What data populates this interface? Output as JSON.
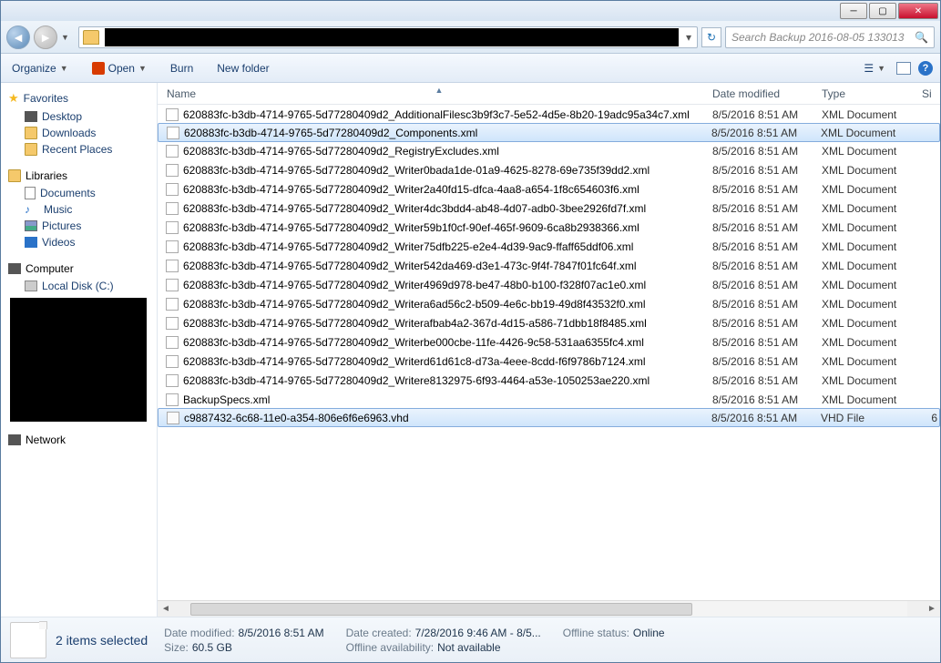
{
  "search": {
    "placeholder": "Search Backup 2016-08-05 133013"
  },
  "toolbar": {
    "organize": "Organize",
    "open": "Open",
    "burn": "Burn",
    "new_folder": "New folder"
  },
  "columns": {
    "name": "Name",
    "date": "Date modified",
    "type": "Type",
    "size": "Si"
  },
  "sidebar": {
    "favorites": {
      "label": "Favorites",
      "items": [
        "Desktop",
        "Downloads",
        "Recent Places"
      ]
    },
    "libraries": {
      "label": "Libraries",
      "items": [
        "Documents",
        "Music",
        "Pictures",
        "Videos"
      ]
    },
    "computer": {
      "label": "Computer",
      "items": [
        "Local Disk (C:)"
      ]
    },
    "network": {
      "label": "Network"
    }
  },
  "files": [
    {
      "name": "620883fc-b3db-4714-9765-5d77280409d2_AdditionalFilesc3b9f3c7-5e52-4d5e-8b20-19adc95a34c7.xml",
      "date": "8/5/2016 8:51 AM",
      "type": "XML Document",
      "sel": false,
      "icon": "xml"
    },
    {
      "name": "620883fc-b3db-4714-9765-5d77280409d2_Components.xml",
      "date": "8/5/2016 8:51 AM",
      "type": "XML Document",
      "sel": true,
      "icon": "xml"
    },
    {
      "name": "620883fc-b3db-4714-9765-5d77280409d2_RegistryExcludes.xml",
      "date": "8/5/2016 8:51 AM",
      "type": "XML Document",
      "sel": false,
      "icon": "xml"
    },
    {
      "name": "620883fc-b3db-4714-9765-5d77280409d2_Writer0bada1de-01a9-4625-8278-69e735f39dd2.xml",
      "date": "8/5/2016 8:51 AM",
      "type": "XML Document",
      "sel": false,
      "icon": "xml"
    },
    {
      "name": "620883fc-b3db-4714-9765-5d77280409d2_Writer2a40fd15-dfca-4aa8-a654-1f8c654603f6.xml",
      "date": "8/5/2016 8:51 AM",
      "type": "XML Document",
      "sel": false,
      "icon": "xml"
    },
    {
      "name": "620883fc-b3db-4714-9765-5d77280409d2_Writer4dc3bdd4-ab48-4d07-adb0-3bee2926fd7f.xml",
      "date": "8/5/2016 8:51 AM",
      "type": "XML Document",
      "sel": false,
      "icon": "xml"
    },
    {
      "name": "620883fc-b3db-4714-9765-5d77280409d2_Writer59b1f0cf-90ef-465f-9609-6ca8b2938366.xml",
      "date": "8/5/2016 8:51 AM",
      "type": "XML Document",
      "sel": false,
      "icon": "xml"
    },
    {
      "name": "620883fc-b3db-4714-9765-5d77280409d2_Writer75dfb225-e2e4-4d39-9ac9-ffaff65ddf06.xml",
      "date": "8/5/2016 8:51 AM",
      "type": "XML Document",
      "sel": false,
      "icon": "xml"
    },
    {
      "name": "620883fc-b3db-4714-9765-5d77280409d2_Writer542da469-d3e1-473c-9f4f-7847f01fc64f.xml",
      "date": "8/5/2016 8:51 AM",
      "type": "XML Document",
      "sel": false,
      "icon": "xml"
    },
    {
      "name": "620883fc-b3db-4714-9765-5d77280409d2_Writer4969d978-be47-48b0-b100-f328f07ac1e0.xml",
      "date": "8/5/2016 8:51 AM",
      "type": "XML Document",
      "sel": false,
      "icon": "xml"
    },
    {
      "name": "620883fc-b3db-4714-9765-5d77280409d2_Writera6ad56c2-b509-4e6c-bb19-49d8f43532f0.xml",
      "date": "8/5/2016 8:51 AM",
      "type": "XML Document",
      "sel": false,
      "icon": "xml"
    },
    {
      "name": "620883fc-b3db-4714-9765-5d77280409d2_Writerafbab4a2-367d-4d15-a586-71dbb18f8485.xml",
      "date": "8/5/2016 8:51 AM",
      "type": "XML Document",
      "sel": false,
      "icon": "xml"
    },
    {
      "name": "620883fc-b3db-4714-9765-5d77280409d2_Writerbe000cbe-11fe-4426-9c58-531aa6355fc4.xml",
      "date": "8/5/2016 8:51 AM",
      "type": "XML Document",
      "sel": false,
      "icon": "xml"
    },
    {
      "name": "620883fc-b3db-4714-9765-5d77280409d2_Writerd61d61c8-d73a-4eee-8cdd-f6f9786b7124.xml",
      "date": "8/5/2016 8:51 AM",
      "type": "XML Document",
      "sel": false,
      "icon": "xml"
    },
    {
      "name": "620883fc-b3db-4714-9765-5d77280409d2_Writere8132975-6f93-4464-a53e-1050253ae220.xml",
      "date": "8/5/2016 8:51 AM",
      "type": "XML Document",
      "sel": false,
      "icon": "xml"
    },
    {
      "name": "BackupSpecs.xml",
      "date": "8/5/2016 8:51 AM",
      "type": "XML Document",
      "sel": false,
      "icon": "xml"
    },
    {
      "name": "c9887432-6c68-11e0-a354-806e6f6e6963.vhd",
      "date": "8/5/2016 8:51 AM",
      "type": "VHD File",
      "sel": true,
      "icon": "vhd",
      "sz": "6"
    }
  ],
  "details": {
    "title": "2 items selected",
    "date_modified_label": "Date modified:",
    "date_modified": "8/5/2016 8:51 AM",
    "size_label": "Size:",
    "size": "60.5 GB",
    "date_created_label": "Date created:",
    "date_created": "7/28/2016 9:46 AM - 8/5...",
    "offline_avail_label": "Offline availability:",
    "offline_avail": "Not available",
    "offline_status_label": "Offline status:",
    "offline_status": "Online"
  }
}
